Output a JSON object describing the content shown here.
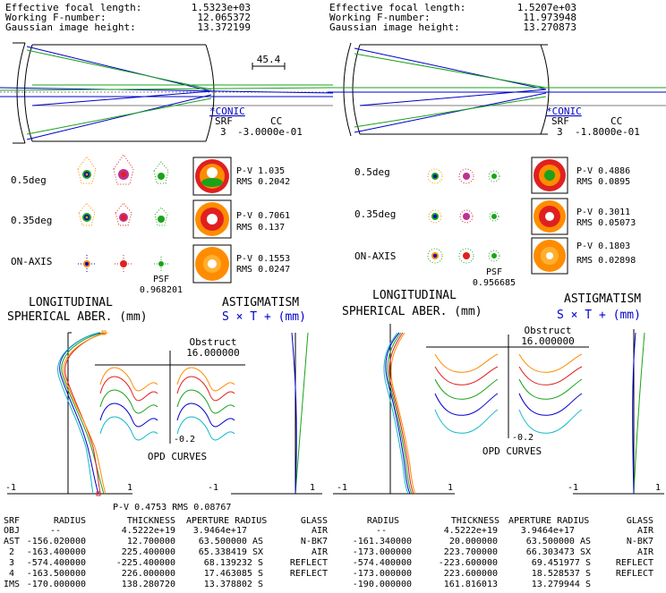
{
  "panels": [
    {
      "header": [
        {
          "label": "Effective focal length:",
          "value": "1.5323e+03"
        },
        {
          "label": "Working F-number:",
          "value": "12.065372"
        },
        {
          "label": "Gaussian image height:",
          "value": "13.372199"
        }
      ],
      "scale_value": "45.4",
      "conic": {
        "title": "*CONIC",
        "srf_label": "SRF",
        "cc_label": "CC",
        "srf": "3",
        "cc": "-3.0000e-01"
      },
      "spots": [
        {
          "field": "0.5deg",
          "pv": "P-V 1.035",
          "rms": "RMS 0.2042"
        },
        {
          "field": "0.35deg",
          "pv": "P-V 0.7061",
          "rms": "RMS 0.137"
        },
        {
          "field": "ON-AXIS",
          "pv": "P-V 0.1553",
          "rms": "RMS 0.0247"
        }
      ],
      "psf_label": "PSF",
      "psf_value": "0.968201",
      "lsa_title": [
        "LONGITUDINAL",
        "SPHERICAL ABER. (mm)"
      ],
      "ast_title": "ASTIGMATISM",
      "ast_legend": "S × T + (mm)",
      "obstruct_label": "Obstruct",
      "obstruct_value": "16.000000",
      "opd_scale": "-0.2",
      "opd_label": "OPD CURVES",
      "axis_min": "-1",
      "axis_max": "1",
      "bottom_summary": "P-V 0.4753 RMS 0.08767",
      "table": {
        "columns": [
          "SRF",
          "RADIUS",
          "THICKNESS",
          "APERTURE RADIUS",
          "GLASS"
        ],
        "rows": [
          [
            "OBJ",
            "--",
            "4.5222e+19",
            "3.9464e+17",
            "AIR"
          ],
          [
            "AST",
            "-156.020000",
            "12.700000",
            "63.500000 AS",
            "N-BK7"
          ],
          [
            "2",
            "-163.400000",
            "225.400000",
            "65.338419 SX",
            "AIR"
          ],
          [
            "3",
            "-574.400000",
            "-225.400000",
            "68.139232 S",
            "REFLECT"
          ],
          [
            "4",
            "-163.500000",
            "226.000000",
            "17.463085 S",
            "REFLECT"
          ],
          [
            "IMS",
            "-170.000000",
            "138.280720",
            "13.378802 S",
            ""
          ]
        ]
      }
    },
    {
      "header": [
        {
          "label": "Effective focal length:",
          "value": "1.5207e+03"
        },
        {
          "label": "Working F-number:",
          "value": "11.973948"
        },
        {
          "label": "Gaussian image height:",
          "value": "13.270873"
        }
      ],
      "scale_value": "",
      "conic": {
        "title": "*CONIC",
        "srf_label": "SRF",
        "cc_label": "CC",
        "srf": "3",
        "cc": "-1.8000e-01"
      },
      "spots": [
        {
          "field": "0.5deg",
          "pv": "P-V 0.4886",
          "rms": "RMS 0.0895"
        },
        {
          "field": "0.35deg",
          "pv": "P-V 0.3011",
          "rms": "RMS 0.05073"
        },
        {
          "field": "ON-AXIS",
          "pv": "P-V 0.1803",
          "rms": "RMS 0.02898"
        }
      ],
      "psf_label": "PSF",
      "psf_value": "0.956685",
      "lsa_title": [
        "LONGITUDINAL",
        "SPHERICAL ABER. (mm)"
      ],
      "ast_title": "ASTIGMATISM",
      "ast_legend": "S × T + (mm)",
      "obstruct_label": "Obstruct",
      "obstruct_value": "16.000000",
      "opd_scale": "-0.2",
      "opd_label": "OPD CURVES",
      "axis_min": "-1",
      "axis_max": "1",
      "bottom_summary": "",
      "table": {
        "columns": [
          "",
          "RADIUS",
          "THICKNESS",
          "APERTURE RADIUS",
          "GLASS"
        ],
        "rows": [
          [
            "",
            "--",
            "4.5222e+19",
            "3.9464e+17",
            "AIR"
          ],
          [
            "",
            "-161.340000",
            "20.000000",
            "63.500000 AS",
            "N-BK7"
          ],
          [
            "",
            "-173.000000",
            "223.700000",
            "66.303473 SX",
            "AIR"
          ],
          [
            "",
            "-574.400000",
            "-223.600000",
            "69.451977 S",
            "REFLECT"
          ],
          [
            "",
            "-173.000000",
            "223.600000",
            "18.528537 S",
            "REFLECT"
          ],
          [
            "",
            "-190.000000",
            "161.816013",
            "13.279944 S",
            ""
          ]
        ]
      }
    }
  ],
  "colors": {
    "blue": "#0000cc",
    "green": "#1aa31a",
    "red": "#e02020",
    "orange": "#ff8c00",
    "cyan": "#10b8c8"
  }
}
